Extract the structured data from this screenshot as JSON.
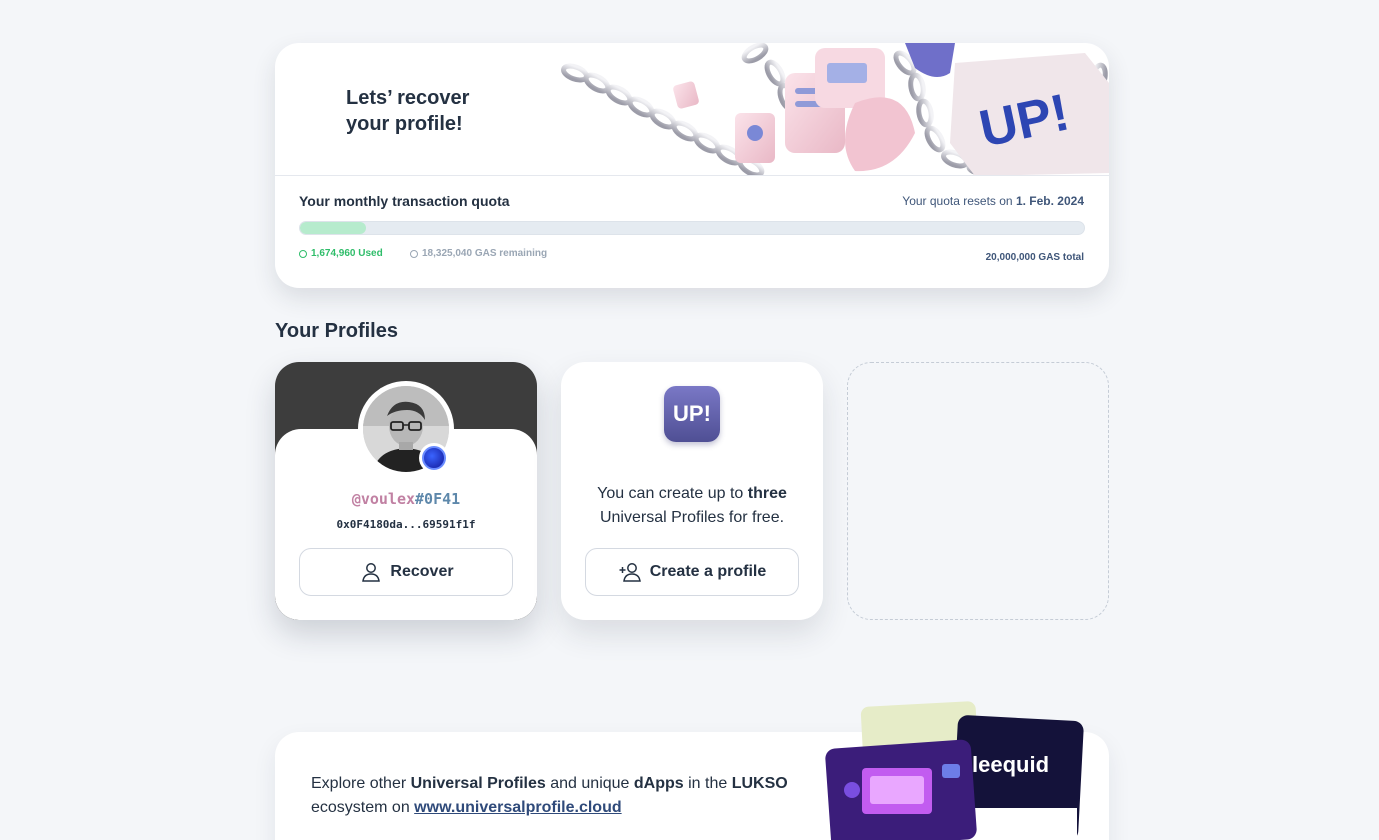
{
  "hero": {
    "title_line1": "Lets’ recover",
    "title_line2": "your profile!",
    "art_label": "UP!"
  },
  "quota": {
    "title": "Your monthly transaction quota",
    "reset_prefix": "Your quota resets on",
    "reset_date": "1. Feb. 2024",
    "used_label": "1,674,960 Used",
    "remaining_label": "18,325,040 GAS remaining",
    "total_label": "20,000,000 GAS total",
    "used_fraction": 0.0837,
    "colors": {
      "used": "#2fbd6a",
      "bar_fill": "#b6ebcd",
      "track": "#e5ebf1"
    }
  },
  "profiles": {
    "section_title": "Your Profiles",
    "items": [
      {
        "handle_name": "@voulex",
        "handle_tag": "#0F41",
        "address": "0x0F4180da...69591f1f",
        "action_label": "Recover",
        "action_icon": "user-icon"
      }
    ],
    "create": {
      "logo_text": "UP!",
      "text_prefix": "You can create up to",
      "text_bold": "three",
      "text_suffix": "Universal Profiles for free.",
      "button_label": "Create a profile",
      "button_icon": "add-user-icon"
    }
  },
  "explore": {
    "text_1": "Explore other",
    "bold_1": "Universal Profiles",
    "text_2": "and unique",
    "bold_2": "dApps",
    "text_3": "in the",
    "bold_3": "LUKSO",
    "text_4": "ecosystem on",
    "link_label": "www.universalprofile.cloud",
    "art_card_brand": "leequid"
  }
}
